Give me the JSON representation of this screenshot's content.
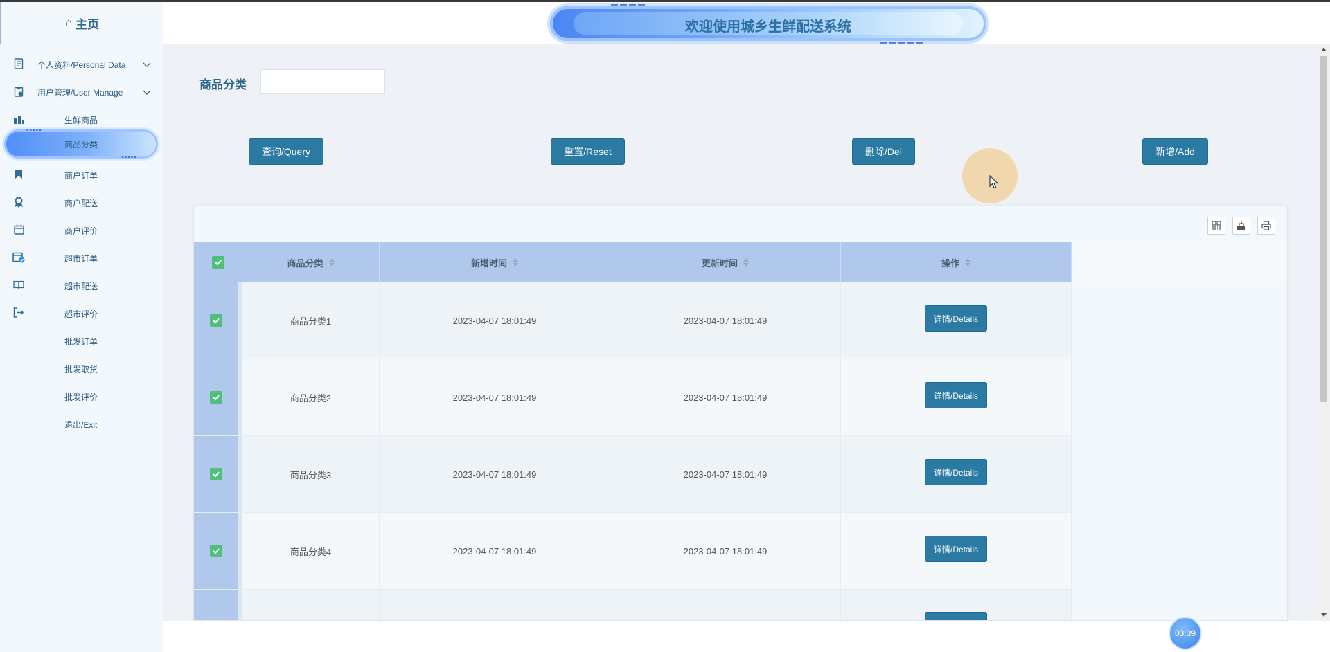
{
  "sidebar": {
    "home_label": "主页",
    "items": [
      {
        "label": "个人资料/Personal Data",
        "icon": "document-icon",
        "has_children": true
      },
      {
        "label": "用户管理/User Manage",
        "icon": "clipboard-user-icon",
        "has_children": true
      },
      {
        "label": "生鲜商品",
        "icon": "buildings-icon"
      },
      {
        "label": "商品分类",
        "active": true
      },
      {
        "label": "商户订单",
        "icon": "bookmark-icon"
      },
      {
        "label": "商户配送",
        "icon": "award-icon"
      },
      {
        "label": "商户评价",
        "icon": "calendar-icon"
      },
      {
        "label": "超市订单",
        "icon": "calendar-check-icon"
      },
      {
        "label": "超市配送",
        "icon": "book-open-icon"
      },
      {
        "label": "超市评价",
        "icon": "logout-icon"
      },
      {
        "label": "批发订单"
      },
      {
        "label": "批发取货"
      },
      {
        "label": "批发评价"
      },
      {
        "label": "退出/Exit"
      }
    ]
  },
  "header": {
    "title": "欢迎使用城乡生鲜配送系统"
  },
  "search": {
    "label": "商品分类",
    "value": ""
  },
  "buttons": {
    "query": "查询/Query",
    "reset": "重置/Reset",
    "delete": "删除/Del",
    "add": "新增/Add"
  },
  "table": {
    "columns": [
      "商品分类",
      "新增时间",
      "更新时间",
      "操作"
    ],
    "rows": [
      {
        "category": "商品分类1",
        "created": "2023-04-07 18:01:49",
        "updated": "2023-04-07 18:01:49",
        "action": "详情/Details",
        "checked": true
      },
      {
        "category": "商品分类2",
        "created": "2023-04-07 18:01:49",
        "updated": "2023-04-07 18:01:49",
        "action": "详情/Details",
        "checked": true
      },
      {
        "category": "商品分类3",
        "created": "2023-04-07 18:01:49",
        "updated": "2023-04-07 18:01:49",
        "action": "详情/Details",
        "checked": true
      },
      {
        "category": "商品分类4",
        "created": "2023-04-07 18:01:49",
        "updated": "2023-04-07 18:01:49",
        "action": "详情/Details",
        "checked": true
      }
    ]
  },
  "clock": "03:39",
  "colors": {
    "primary_button": "#2a7aa3",
    "header_cell": "#b0c8ec",
    "checkbox": "#4fbf7a",
    "sidebar_bg": "#f3f8fc"
  }
}
